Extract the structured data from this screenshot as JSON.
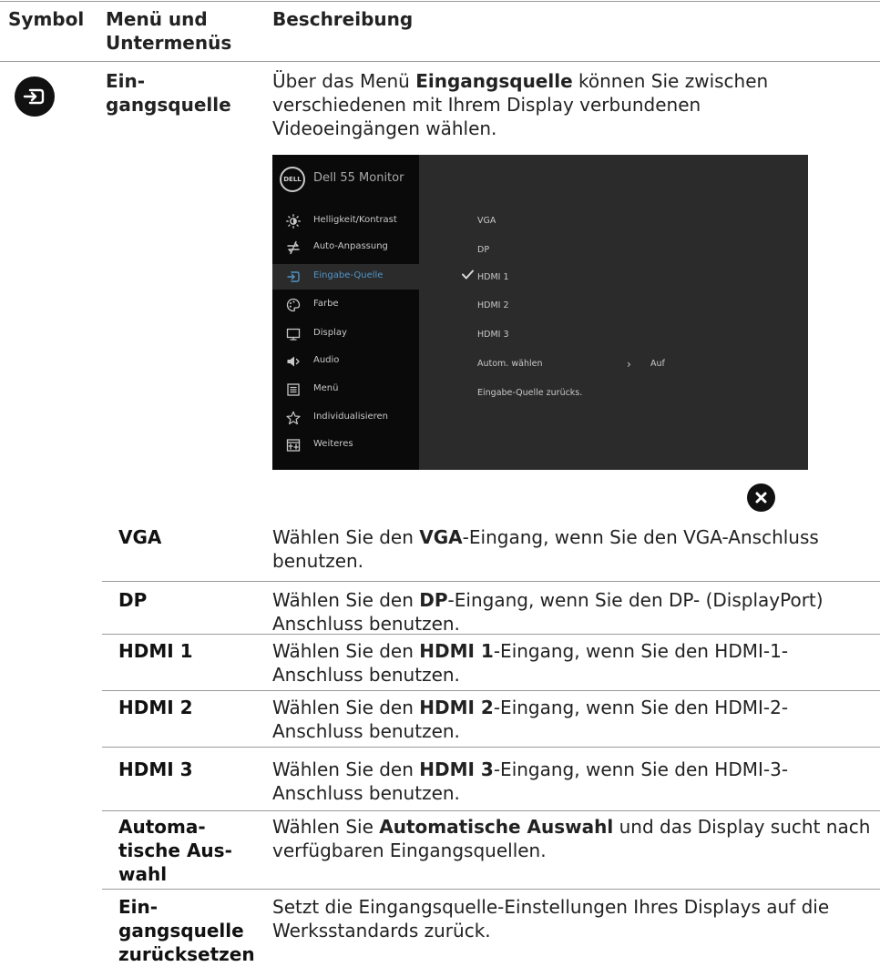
{
  "header": {
    "symbol": "Symbol",
    "menu_line1": "Menü und",
    "menu_line2": "Untermenüs",
    "description": "Beschreibung"
  },
  "main": {
    "menu_line1": "Ein-",
    "menu_line2": "gangsquelle",
    "desc_pre": "Über das Menü ",
    "desc_bold": "Eingangsquelle",
    "desc_post": " können Sie zwischen verschiedenen mit Ihrem Display verbundenen Videoeingängen wählen."
  },
  "osd": {
    "logo": "DELL",
    "title": "Dell 55 Monitor",
    "menu": [
      {
        "label": "Helligkeit/Kontrast",
        "icon": "brightness-icon"
      },
      {
        "label": "Auto-Anpassung",
        "icon": "auto-adjust-icon"
      },
      {
        "label": "Eingabe-Quelle",
        "icon": "input-source-icon"
      },
      {
        "label": "Farbe",
        "icon": "palette-icon"
      },
      {
        "label": "Display",
        "icon": "display-icon"
      },
      {
        "label": "Audio",
        "icon": "speaker-icon"
      },
      {
        "label": "Menü",
        "icon": "menu-icon"
      },
      {
        "label": "Individualisieren",
        "icon": "star-icon"
      },
      {
        "label": "Weiteres",
        "icon": "others-icon"
      }
    ],
    "options": [
      "VGA",
      "DP",
      "HDMI 1",
      "HDMI 2",
      "HDMI 3",
      "Autom. wählen",
      "Eingabe-Quelle zurücks."
    ],
    "selected": "HDMI 1",
    "auto_value": "Auf",
    "accent_color": "#4f95c8"
  },
  "rows": [
    {
      "label": "VGA",
      "pre": "Wählen Sie den ",
      "bold": "VGA",
      "post": "-Eingang, wenn Sie den VGA-Anschluss benutzen."
    },
    {
      "label": "DP",
      "pre": "Wählen Sie den ",
      "bold": "DP",
      "post": "-Eingang, wenn Sie den DP- (DisplayPort) Anschluss benutzen."
    },
    {
      "label": "HDMI 1",
      "pre": "Wählen Sie den ",
      "bold": "HDMI 1",
      "post": "-Eingang, wenn Sie den HDMI-1-Anschluss benutzen."
    },
    {
      "label": "HDMI 2",
      "pre": "Wählen Sie den ",
      "bold": "HDMI 2",
      "post": "-Eingang, wenn Sie den HDMI-2-Anschluss benutzen."
    },
    {
      "label": "HDMI 3",
      "pre": "Wählen Sie den ",
      "bold": "HDMI 3",
      "post": "-Eingang, wenn Sie den HDMI-3-Anschluss benutzen."
    },
    {
      "label_lines": [
        "Automa-",
        "tische Aus-",
        "wahl"
      ],
      "pre": "Wählen Sie ",
      "bold": "Automatische Auswahl",
      "post": " und das Display sucht nach verfügbaren Eingangsquellen."
    },
    {
      "label_lines": [
        "Ein-",
        "gangsquelle",
        "zurücksetzen"
      ],
      "pre": "Setzt die Eingangsquelle-Einstellungen Ihres Displays auf die Werksstandards zurück.",
      "bold": "",
      "post": ""
    }
  ]
}
